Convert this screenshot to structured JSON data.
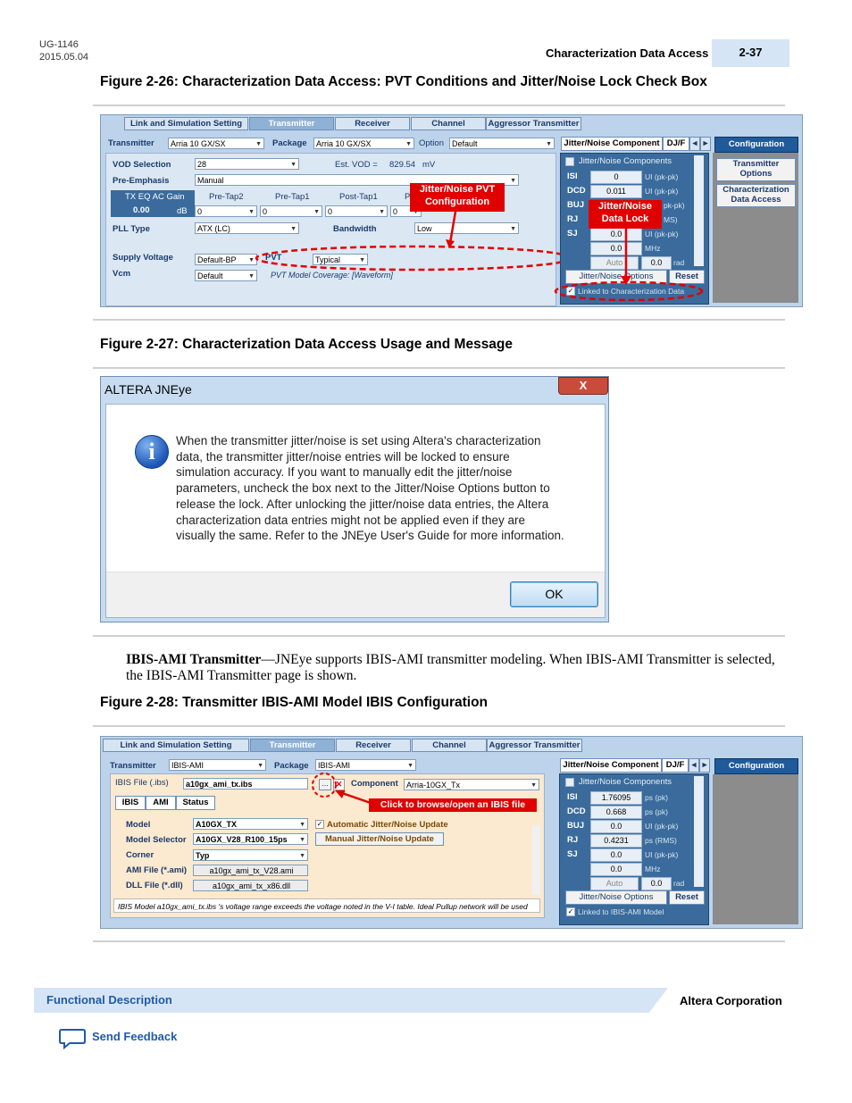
{
  "header": {
    "doc_id": "UG-1146",
    "doc_date": "2015.05.04",
    "section_title": "Characterization Data Access",
    "page_number": "2-37"
  },
  "figure26": {
    "caption": "Figure 2-26: Characterization Data Access: PVT Conditions and Jitter/Noise Lock Check Box",
    "tabs": [
      "Link and Simulation Setting",
      "Transmitter",
      "Receiver",
      "Channel",
      "Aggressor Transmitter"
    ],
    "transmitter_label": "Transmitter",
    "transmitter_value": "Arria 10 GX/SX",
    "package_label": "Package",
    "package_value": "Arria 10 GX/SX",
    "option_label": "Option",
    "option_value": "Default",
    "vod_label": "VOD Selection",
    "vod_value": "28",
    "est_vod_label": "Est. VOD =",
    "est_vod_value": "829.54",
    "est_vod_unit": "mV",
    "pre_emphasis_label": "Pre-Emphasis",
    "pre_emphasis_value": "Manual",
    "tx_eq_label": "TX EQ AC Gain",
    "tx_eq_value": "0.00",
    "tx_eq_unit": "dB",
    "pre_tap2_label": "Pre-Tap2",
    "pre_tap1_label": "Pre-Tap1",
    "post_tap1_label": "Post-Tap1",
    "post_tap2_label": "P",
    "tap_values": [
      "0",
      "0",
      "0",
      "0"
    ],
    "pll_label": "PLL Type",
    "pll_value": "ATX (LC)",
    "bandwidth_label": "Bandwidth",
    "bandwidth_value": "Low",
    "supply_label": "Supply Voltage",
    "supply_value": "Default-BP",
    "pvt_label": "PVT",
    "pvt_value": "Typical",
    "vcm_label": "Vcm",
    "vcm_value": "Default",
    "pvt_coverage": "PVT Model Coverage: [Waveform]",
    "jn_tab": "Jitter/Noise Component",
    "djf_tab": "DJ/F",
    "jn_components": "Jitter/Noise Components",
    "rows": [
      {
        "name": "ISI",
        "value": "0",
        "unit": "UI (pk-pk)"
      },
      {
        "name": "DCD",
        "value": "0.011",
        "unit": "UI (pk-pk)"
      },
      {
        "name": "BUJ",
        "value": "",
        "unit": "pk-pk)"
      },
      {
        "name": "RJ",
        "value": "",
        "unit": "MS)"
      },
      {
        "name": "SJ",
        "value": "0.0",
        "unit": "UI (pk-pk)"
      }
    ],
    "sj_freq_value": "0.0",
    "sj_freq_unit": "MHz",
    "auto_label": "Auto",
    "rad_value": "0.0",
    "rad_unit": "rad",
    "jn_options_btn": "Jitter/Noise Options",
    "reset_btn": "Reset",
    "linked_label": "Linked to Characterization Data",
    "configuration": "Configuration",
    "tx_options": "Transmitter Options",
    "char_data_access": "Characterization Data Access",
    "callout_pvt": "Jitter/Noise PVT Configuration",
    "callout_lock": "Jitter/Noise Data Lock"
  },
  "figure27": {
    "caption": "Figure 2-27: Characterization Data Access Usage and Message",
    "dialog_title": "ALTERA JNEye",
    "close": "X",
    "message_lines": [
      "When the transmitter jitter/noise is set using Altera's characterization",
      "data, the transmitter jitter/noise entries will be locked to ensure",
      "simulation accuracy. If you want to manually edit the jitter/noise",
      "parameters, uncheck the box next to the Jitter/Noise Options button to",
      "release the lock. After unlocking the jitter/noise data entries, the Altera",
      "characterization data entries might not be applied even if they are",
      "visually the same. Refer to the JNEye User's Guide for more information."
    ],
    "ok": "OK"
  },
  "body": {
    "bold_term": "IBIS-AMI Transmitter",
    "text": "—JNEye supports IBIS-AMI transmitter modeling. When IBIS-AMI Transmitter is selected, the IBIS-AMI Transmitter page is shown."
  },
  "figure28": {
    "caption": "Figure 2-28: Transmitter IBIS-AMI Model IBIS Configuration",
    "tabs": [
      "Link and Simulation Setting",
      "Transmitter",
      "Receiver",
      "Channel",
      "Aggressor Transmitter"
    ],
    "transmitter_label": "Transmitter",
    "transmitter_value": "IBIS-AMI",
    "package_label": "Package",
    "package_value": "IBIS-AMI",
    "ibis_file_label": "IBIS File (.ibs)",
    "ibis_file_value": "a10gx_ami_tx.ibs",
    "component_label": "Component",
    "component_value": "Arria-10GX_Tx",
    "subtabs": [
      "IBIS",
      "AMI",
      "Status"
    ],
    "model_label": "Model",
    "model_value": "A10GX_TX",
    "model_selector_label": "Model Selector",
    "model_selector_value": "A10GX_V28_R100_15ps",
    "corner_label": "Corner",
    "corner_value": "Typ",
    "ami_file_label": "AMI File (*.ami)",
    "ami_file_value": "a10gx_ami_tx_V28.ami",
    "dll_file_label": "DLL File (*.dll)",
    "dll_file_value": "a10gx_ami_tx_x86.dll",
    "auto_update": "Automatic Jitter/Noise Update",
    "manual_update": "Manual Jitter/Noise Update",
    "status_msg": "IBIS Model a10gx_ami_tx.ibs 's voltage range exceeds the voltage noted in the V-I table. Ideal Pullup network will be used",
    "callout_browse": "Click to browse/open an IBIS file",
    "jn_tab": "Jitter/Noise Component",
    "djf_tab": "DJ/F",
    "jn_components": "Jitter/Noise Components",
    "rows": [
      {
        "name": "ISI",
        "value": "1.76095",
        "unit": "ps (pk)"
      },
      {
        "name": "DCD",
        "value": "0.668",
        "unit": "ps (pk)"
      },
      {
        "name": "BUJ",
        "value": "0.0",
        "unit": "UI (pk-pk)"
      },
      {
        "name": "RJ",
        "value": "0.4231",
        "unit": "ps (RMS)"
      },
      {
        "name": "SJ",
        "value": "0.0",
        "unit": "UI (pk-pk)"
      }
    ],
    "sj_freq_value": "0.0",
    "sj_freq_unit": "MHz",
    "auto_label": "Auto",
    "rad_value": "0.0",
    "rad_unit": "rad",
    "jn_options_btn": "Jitter/Noise Options",
    "reset_btn": "Reset",
    "linked_label": "Linked to IBIS-AMI Model",
    "configuration": "Configuration"
  },
  "footer": {
    "section": "Functional Description",
    "company": "Altera Corporation",
    "feedback": "Send Feedback"
  }
}
